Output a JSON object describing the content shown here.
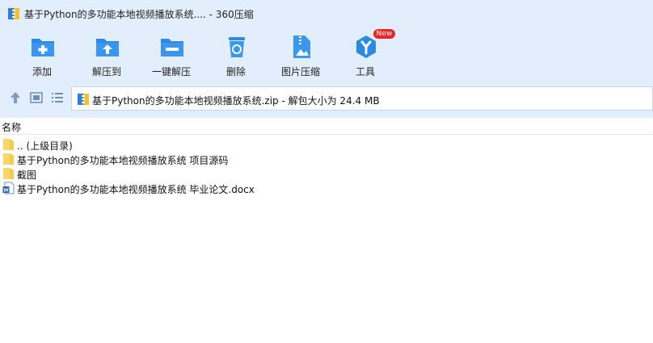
{
  "window": {
    "title": "基于Python的多功能本地视频播放系统.... - 360压缩"
  },
  "toolbar": {
    "add_label": "添加",
    "extract_label": "解压到",
    "one_click_label": "一键解压",
    "delete_label": "删除",
    "image_compress_label": "图片压缩",
    "tools_label": "工具",
    "tools_badge": "New"
  },
  "address": {
    "text": "基于Python的多功能本地视频播放系统.zip - 解包大小为 24.4 MB"
  },
  "list": {
    "header_name": "名称",
    "items": [
      {
        "name": ".. (上级目录)",
        "type": "folder"
      },
      {
        "name": "基于Python的多功能本地视频播放系统 项目源码",
        "type": "folder"
      },
      {
        "name": "截图",
        "type": "folder"
      },
      {
        "name": "基于Python的多功能本地视频播放系统 毕业论文.docx",
        "type": "word-document"
      }
    ]
  },
  "colors": {
    "toolbar_bg": "#e2eefb",
    "icon_blue": "#2b8ae6",
    "badge_red": "#e8262a",
    "folder_yellow": "#f5c949"
  }
}
